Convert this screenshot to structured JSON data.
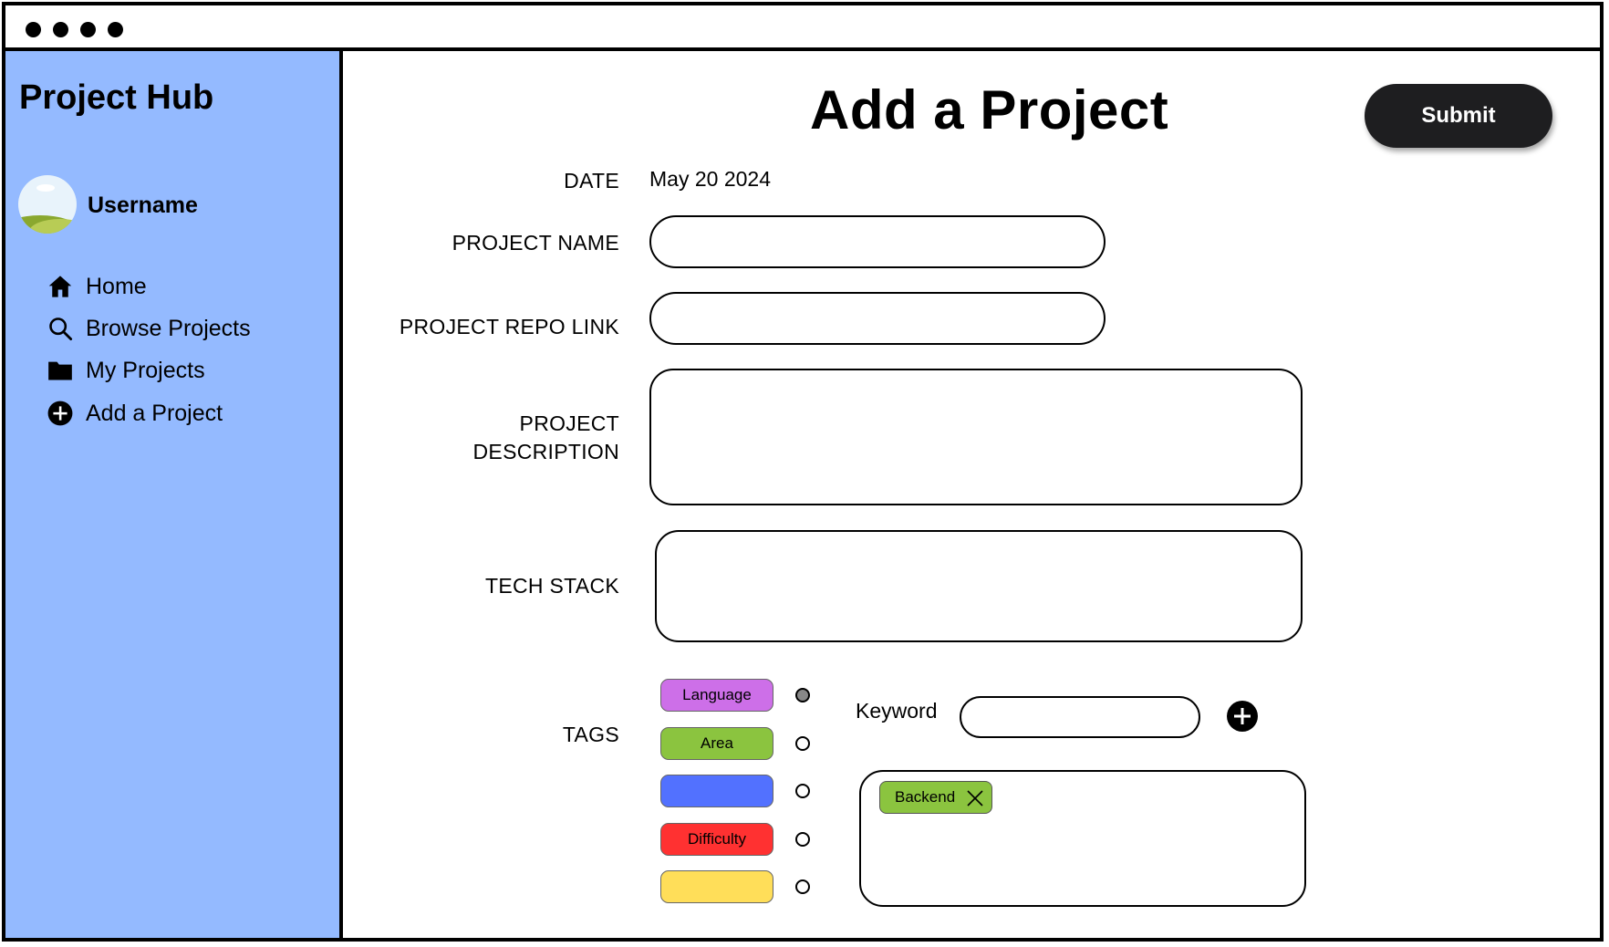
{
  "app": {
    "title": "Project Hub"
  },
  "user": {
    "name": "Username"
  },
  "nav": {
    "items": [
      {
        "label": "Home",
        "icon": "home-icon"
      },
      {
        "label": "Browse Projects",
        "icon": "search-icon"
      },
      {
        "label": "My Projects",
        "icon": "folder-icon"
      },
      {
        "label": "Add a Project",
        "icon": "plus-circle-icon"
      }
    ]
  },
  "page": {
    "title": "Add a Project",
    "submit_label": "Submit"
  },
  "form": {
    "date_label": "DATE",
    "date_value": "May 20 2024",
    "project_name_label": "PROJECT NAME",
    "project_name_value": "",
    "repo_link_label": "PROJECT REPO LINK",
    "repo_link_value": "",
    "description_label_line1": "PROJECT",
    "description_label_line2": "DESCRIPTION",
    "description_value": "",
    "tech_stack_label": "TECH STACK",
    "tech_stack_value": "",
    "tags_label": "TAGS"
  },
  "tags": {
    "categories": [
      {
        "label": "Language",
        "color": "#cd6fe8",
        "selected": true
      },
      {
        "label": "Area",
        "color": "#8bc43f",
        "selected": false
      },
      {
        "label": "",
        "color": "#5271ff",
        "selected": false
      },
      {
        "label": "Difficulty",
        "color": "#ff3131",
        "selected": false
      },
      {
        "label": "",
        "color": "#ffde59",
        "selected": false
      }
    ],
    "keyword_label": "Keyword",
    "keyword_value": "",
    "added": [
      {
        "label": "Backend",
        "color": "#8bc43f"
      }
    ]
  },
  "colors": {
    "sidebar": "#94baff",
    "submit_bg": "#1e1e20"
  }
}
